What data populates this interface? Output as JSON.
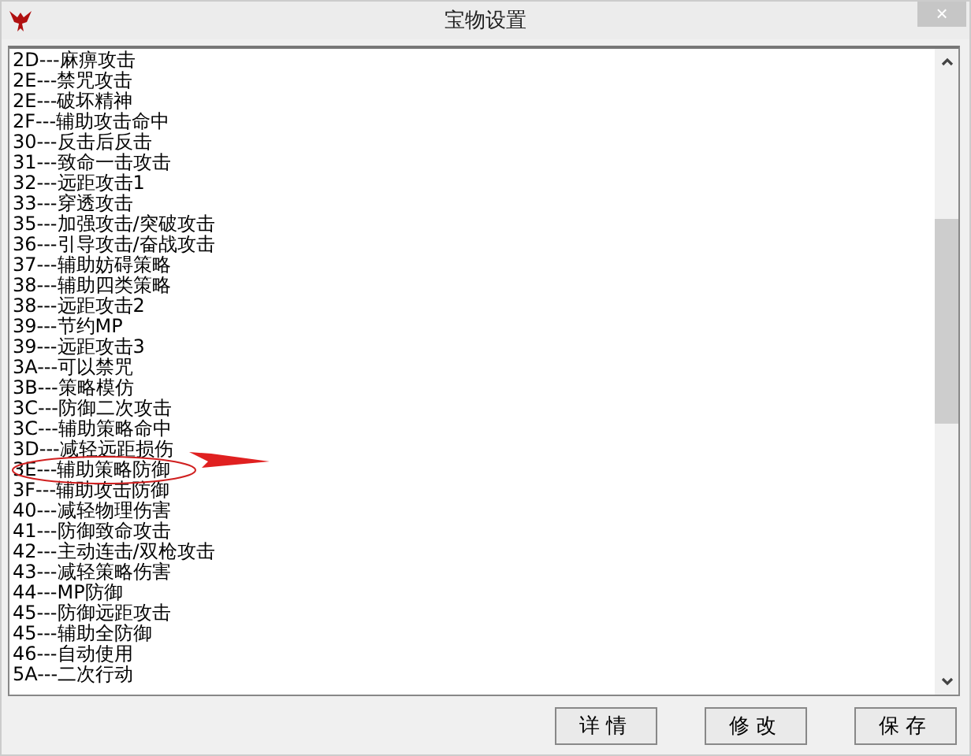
{
  "window": {
    "title": "宝物设置",
    "close": "×"
  },
  "list": {
    "items": [
      "2D---麻痹攻击",
      "2E---禁咒攻击",
      "2E---破坏精神",
      "2F---辅助攻击命中",
      "30---反击后反击",
      "31---致命一击攻击",
      "32---远距攻击1",
      "33---穿透攻击",
      "35---加强攻击/突破攻击",
      "36---引导攻击/奋战攻击",
      "37---辅助妨碍策略",
      "38---辅助四类策略",
      "38---远距攻击2",
      "39---节约MP",
      "39---远距攻击3",
      "3A---可以禁咒",
      "3B---策略模仿",
      "3C---防御二次攻击",
      "3C---辅助策略命中",
      "3D---减轻远距损伤",
      "3E---辅助策略防御",
      "3F---辅助攻击防御",
      "40---减轻物理伤害",
      "41---防御致命攻击",
      "42---主动连击/双枪攻击",
      "43---减轻策略伤害",
      "44---MP防御",
      "45---防御远距攻击",
      "45---辅助全防御",
      "46---自动使用",
      "5A---二次行动"
    ]
  },
  "buttons": [
    "详情",
    "修改",
    "保存"
  ]
}
